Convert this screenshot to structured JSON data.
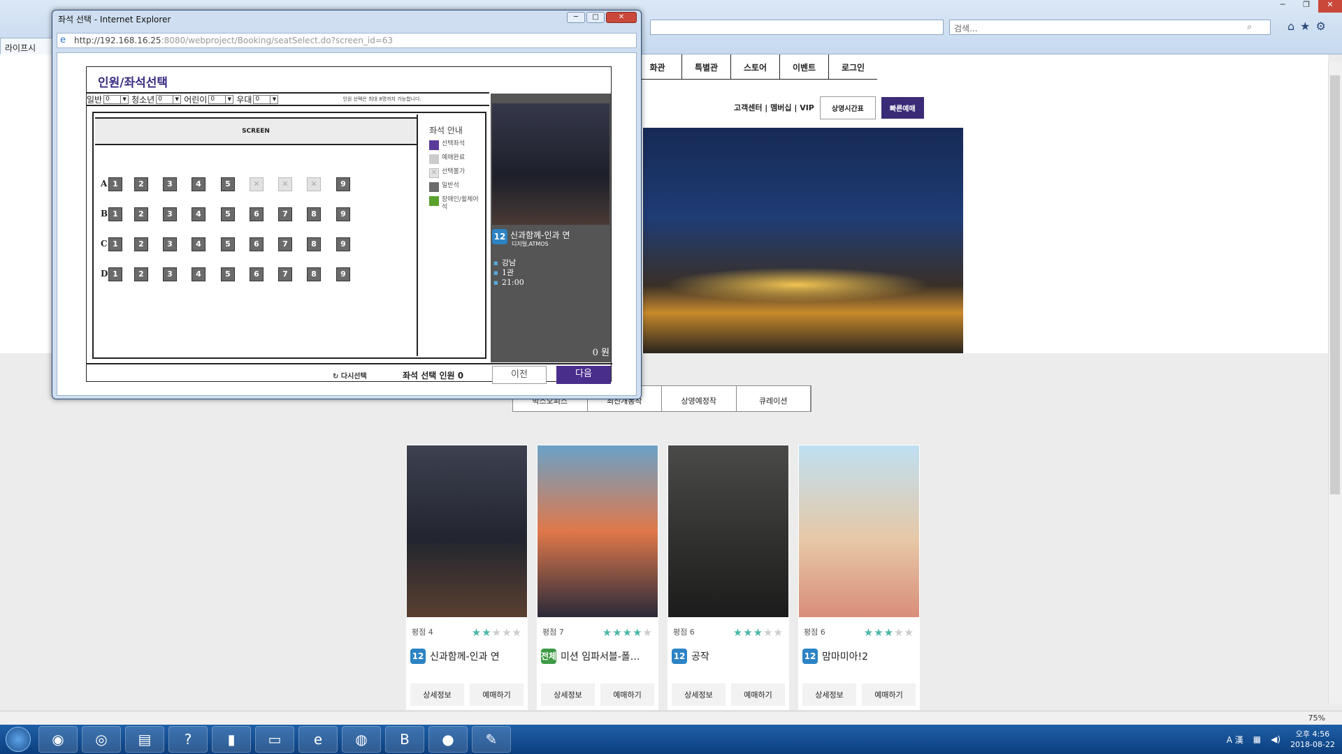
{
  "background": {
    "search_placeholder": "검색...",
    "tab_label": "라이프시",
    "nav": [
      "화관",
      "특별관",
      "스토어",
      "이벤트",
      "로그인"
    ],
    "subnav_links": "고객센터 | 멤버십 | VIP",
    "schedule_btn": "상영시간표",
    "fast_btn": "빠른예매",
    "movie_tabs": [
      "박스오피스",
      "최신개봉작",
      "상영예정작",
      "큐레이션"
    ],
    "movies": [
      {
        "rating_label": "평점 4",
        "stars": 2.5,
        "age": "12",
        "title": "신과함께-인과 연"
      },
      {
        "rating_label": "평점 7",
        "stars": 4,
        "age": "전체",
        "title": "미션 임파서블-폴…"
      },
      {
        "rating_label": "평점 6",
        "stars": 3,
        "age": "12",
        "title": "공작"
      },
      {
        "rating_label": "평점 6",
        "stars": 3,
        "age": "12",
        "title": "맘마미아!2"
      }
    ],
    "detail_btn": "상세정보",
    "book_btn": "예매하기",
    "zoom": "75%"
  },
  "taskbar": {
    "time": "오후 4:56",
    "date": "2018-08-22"
  },
  "popup": {
    "title": "좌석 선택 - Internet Explorer",
    "url_host": "http://192.168.16.25",
    "url_path": ":8080/webproject/Booking/seatSelect.do?screen_id=63",
    "heading": "인원/좌석선택",
    "people": [
      {
        "label": "일반",
        "value": "0"
      },
      {
        "label": "청소년",
        "value": "0"
      },
      {
        "label": "어린이",
        "value": "0"
      },
      {
        "label": "우대",
        "value": "0"
      }
    ],
    "people_note": "인원 선택은 최대 8명까지 가능합니다.",
    "screen_label": "SCREEN",
    "rows": [
      {
        "label": "A",
        "seats": [
          "1",
          "2",
          "3",
          "4",
          "5",
          "",
          "",
          "",
          "9"
        ],
        "blocked": [
          5,
          6,
          7
        ]
      },
      {
        "label": "B",
        "seats": [
          "1",
          "2",
          "3",
          "4",
          "5",
          "6",
          "7",
          "8",
          "9"
        ],
        "blocked": []
      },
      {
        "label": "C",
        "seats": [
          "1",
          "2",
          "3",
          "4",
          "5",
          "6",
          "7",
          "8",
          "9"
        ],
        "blocked": []
      },
      {
        "label": "D",
        "seats": [
          "1",
          "2",
          "3",
          "4",
          "5",
          "6",
          "7",
          "8",
          "9"
        ],
        "blocked": []
      }
    ],
    "guide_title": "좌석 안내",
    "guide": [
      {
        "label": "선택좌석",
        "color": "#5a3a9a"
      },
      {
        "label": "예매완료",
        "color": "#cccccc"
      },
      {
        "label": "선택불가",
        "color": "#e2e2e2"
      },
      {
        "label": "일반석",
        "color": "#6b6b6b"
      },
      {
        "label": "장애인/휠체어석",
        "color": "#5aa02c"
      }
    ],
    "movie_age": "12",
    "movie_title": "신과함께-인과 연",
    "movie_format": "디지털,ATMOS",
    "theater": "강남",
    "hall": "1관",
    "time": "21:00",
    "price": "0 원",
    "retry_label": "다시선택",
    "seat_count_label": "좌석 선택 인원 0",
    "prev_label": "이전",
    "next_label": "다음"
  }
}
